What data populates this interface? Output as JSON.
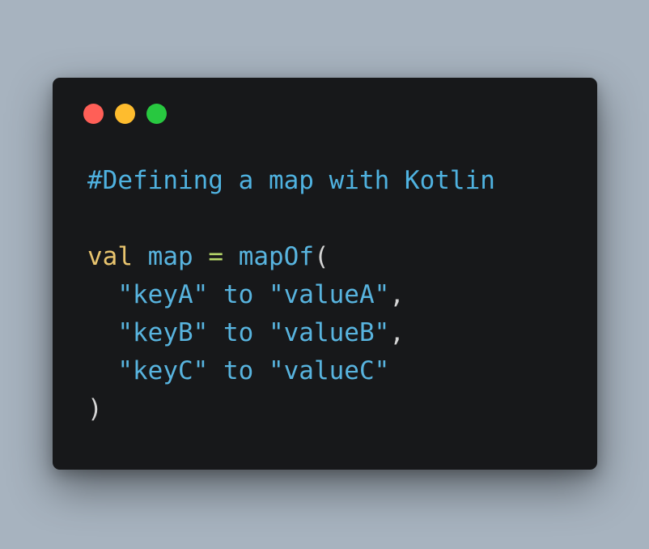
{
  "window": {
    "buttons": {
      "close_color": "#ff5f57",
      "minimize_color": "#febc2e",
      "maximize_color": "#28c840"
    }
  },
  "code": {
    "comment": "#Defining a map with Kotlin",
    "decl_keyword": "val",
    "decl_name": "map",
    "decl_op": "=",
    "decl_call": "mapOf",
    "open_paren": "(",
    "entries": [
      {
        "key": "\"keyA\"",
        "infix": "to",
        "value": "\"valueA\"",
        "sep": ","
      },
      {
        "key": "\"keyB\"",
        "infix": "to",
        "value": "\"valueB\"",
        "sep": ","
      },
      {
        "key": "\"keyC\"",
        "infix": "to",
        "value": "\"valueC\"",
        "sep": ""
      }
    ],
    "close_paren": ")"
  }
}
